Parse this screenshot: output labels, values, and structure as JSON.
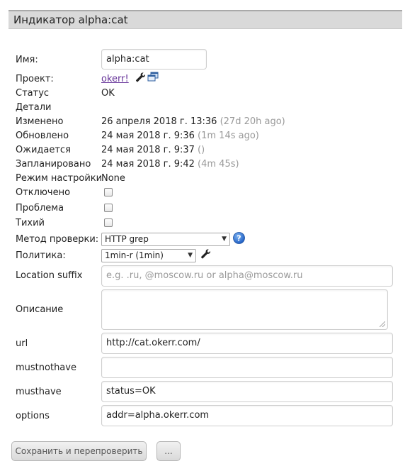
{
  "header": {
    "title": "Индикатор alpha:cat"
  },
  "fields": {
    "name": {
      "label": "Имя:",
      "value": "alpha:cat"
    },
    "project": {
      "label": "Проект:",
      "link": "okerr!"
    },
    "status": {
      "label": "Статус",
      "value": "OK"
    },
    "details": {
      "label": "Детали"
    },
    "changed": {
      "label": "Изменено",
      "value": "26 апреля 2018 г. 13:36",
      "ago": "(27d 20h ago)"
    },
    "updated": {
      "label": "Обновлено",
      "value": "24 мая 2018 г. 9:36",
      "ago": "(1m 14s ago)"
    },
    "expected": {
      "label": "Ожидается",
      "value": "24 мая 2018 г. 9:37",
      "ago": "()"
    },
    "scheduled": {
      "label": "Запланировано",
      "value": "24 мая 2018 г. 9:42",
      "ago": "(4m 45s)"
    },
    "config_mode": {
      "label": "Режим настройки",
      "value": "None"
    },
    "disabled": {
      "label": "Отключено",
      "checked": false
    },
    "problem": {
      "label": "Проблема",
      "checked": false
    },
    "silent": {
      "label": "Тихий",
      "checked": false
    },
    "check_method": {
      "label": "Метод проверки:",
      "selected": "HTTP grep"
    },
    "policy": {
      "label": "Политика:",
      "selected": "1min-r (1min)"
    },
    "location_suffix": {
      "label": "Location suffix",
      "placeholder": "e.g. .ru, @moscow.ru or alpha@moscow.ru"
    },
    "description": {
      "label": "Описание",
      "value": ""
    },
    "url": {
      "label": "url",
      "value": "http://cat.okerr.com/"
    },
    "mustnothave": {
      "label": "mustnothave",
      "value": ""
    },
    "musthave": {
      "label": "musthave",
      "value": "status=OK"
    },
    "options": {
      "label": "options",
      "value": "addr=alpha.okerr.com"
    }
  },
  "buttons": {
    "save": "Сохранить и перепроверить",
    "more": "..."
  },
  "icons": {
    "wrench": "wrench-icon",
    "windows": "windows-icon",
    "help": "help-icon"
  }
}
